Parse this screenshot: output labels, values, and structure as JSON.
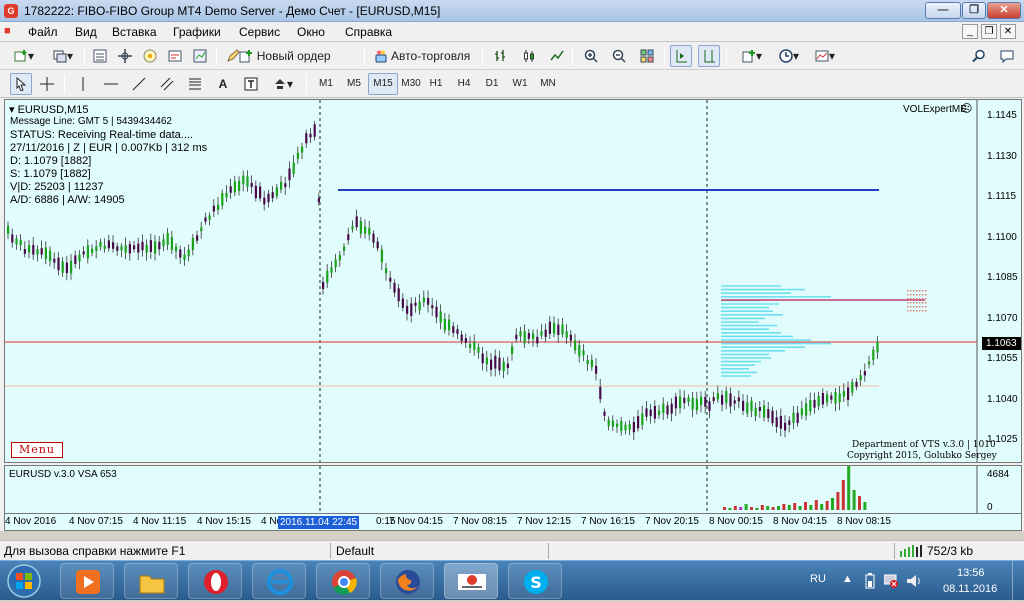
{
  "window": {
    "title": "1782222: FIBO-FIBO Group MT4 Demo Server - Демо Счет - [EURUSD,M15]"
  },
  "menubar": {
    "items": [
      "Файл",
      "Вид",
      "Вставка",
      "Графики",
      "Сервис",
      "Окно",
      "Справка"
    ]
  },
  "toolbar": {
    "new_order": "Новый ордер",
    "autotrading": "Авто-торговля"
  },
  "timeframes": [
    "M1",
    "M5",
    "M15",
    "M30",
    "H1",
    "H4",
    "D1",
    "W1",
    "MN"
  ],
  "active_timeframe": "M15",
  "chart": {
    "symbol_label": "EURUSD,M15",
    "indicator_name": "VOLExpertME",
    "info_lines": [
      "Message Line: GMT 5 | 5439434462",
      "STATUS:  Receiving Real-time data....",
      "27/11/2016 | Z | EUR | 0.007Kb | 312 ms",
      "D: 1.1079  [1882]",
      "S: 1.1079  [1882]",
      "V|D: 25203 | 11237",
      "A/D: 6886 | A/W: 14905"
    ],
    "menu_button": "Menu",
    "copyright": [
      "Department of VTS  v.3.0 | 1010",
      "Copyright 2015, Golubko Sergey"
    ],
    "price_axis": [
      "1.1145",
      "1.1130",
      "1.1115",
      "1.1100",
      "1.1085",
      "1.1070",
      "1.1055",
      "1.1040",
      "1.1025"
    ],
    "current_price": "1.1063",
    "sub_window_label": "EURUSD v.3.0 VSA 653",
    "sub_axis": [
      "4684",
      "0"
    ],
    "time_labels": [
      "4 Nov 2016",
      "4 Nov 07:15",
      "4 Nov 11:15",
      "4 Nov 15:15",
      "4 Nov",
      "0:15",
      "7 Nov 04:15",
      "7 Nov 08:15",
      "7 Nov 12:15",
      "7 Nov 16:15",
      "7 Nov 20:15",
      "8 Nov 00:15",
      "8 Nov 04:15",
      "8 Nov 08:15"
    ],
    "crosshair_time": "2016.11.04 22:45"
  },
  "status": {
    "help": "Для вызова справки нажмите F1",
    "profile": "Default",
    "traffic": "752/3 kb"
  },
  "taskbar": {
    "lang": "RU",
    "time": "13:56",
    "date": "08.11.2016"
  },
  "colors": {
    "chart_bg": "#e1fcfd",
    "bull": "#1aa31a",
    "bear": "#4a0a4a",
    "level_blue": "#2040c0",
    "level_red": "#e03030",
    "profile": "#6fe0f0",
    "crosshair_label": "#1d5fd6"
  }
}
